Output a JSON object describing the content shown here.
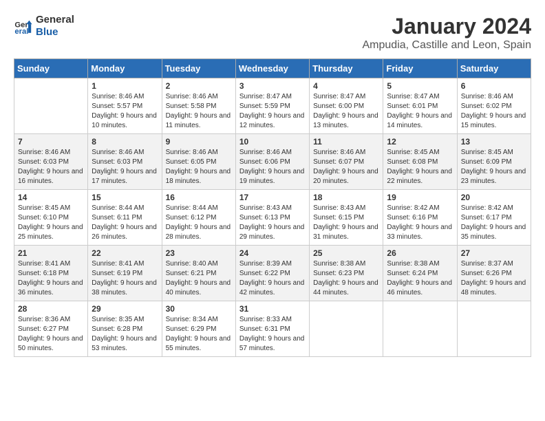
{
  "logo": {
    "line1": "General",
    "line2": "Blue"
  },
  "title": "January 2024",
  "subtitle": "Ampudia, Castille and Leon, Spain",
  "days_of_week": [
    "Sunday",
    "Monday",
    "Tuesday",
    "Wednesday",
    "Thursday",
    "Friday",
    "Saturday"
  ],
  "weeks": [
    [
      {
        "day": "",
        "sunrise": "",
        "sunset": "",
        "daylight": ""
      },
      {
        "day": "1",
        "sunrise": "Sunrise: 8:46 AM",
        "sunset": "Sunset: 5:57 PM",
        "daylight": "Daylight: 9 hours and 10 minutes."
      },
      {
        "day": "2",
        "sunrise": "Sunrise: 8:46 AM",
        "sunset": "Sunset: 5:58 PM",
        "daylight": "Daylight: 9 hours and 11 minutes."
      },
      {
        "day": "3",
        "sunrise": "Sunrise: 8:47 AM",
        "sunset": "Sunset: 5:59 PM",
        "daylight": "Daylight: 9 hours and 12 minutes."
      },
      {
        "day": "4",
        "sunrise": "Sunrise: 8:47 AM",
        "sunset": "Sunset: 6:00 PM",
        "daylight": "Daylight: 9 hours and 13 minutes."
      },
      {
        "day": "5",
        "sunrise": "Sunrise: 8:47 AM",
        "sunset": "Sunset: 6:01 PM",
        "daylight": "Daylight: 9 hours and 14 minutes."
      },
      {
        "day": "6",
        "sunrise": "Sunrise: 8:46 AM",
        "sunset": "Sunset: 6:02 PM",
        "daylight": "Daylight: 9 hours and 15 minutes."
      }
    ],
    [
      {
        "day": "7",
        "sunrise": "Sunrise: 8:46 AM",
        "sunset": "Sunset: 6:03 PM",
        "daylight": "Daylight: 9 hours and 16 minutes."
      },
      {
        "day": "8",
        "sunrise": "Sunrise: 8:46 AM",
        "sunset": "Sunset: 6:03 PM",
        "daylight": "Daylight: 9 hours and 17 minutes."
      },
      {
        "day": "9",
        "sunrise": "Sunrise: 8:46 AM",
        "sunset": "Sunset: 6:05 PM",
        "daylight": "Daylight: 9 hours and 18 minutes."
      },
      {
        "day": "10",
        "sunrise": "Sunrise: 8:46 AM",
        "sunset": "Sunset: 6:06 PM",
        "daylight": "Daylight: 9 hours and 19 minutes."
      },
      {
        "day": "11",
        "sunrise": "Sunrise: 8:46 AM",
        "sunset": "Sunset: 6:07 PM",
        "daylight": "Daylight: 9 hours and 20 minutes."
      },
      {
        "day": "12",
        "sunrise": "Sunrise: 8:45 AM",
        "sunset": "Sunset: 6:08 PM",
        "daylight": "Daylight: 9 hours and 22 minutes."
      },
      {
        "day": "13",
        "sunrise": "Sunrise: 8:45 AM",
        "sunset": "Sunset: 6:09 PM",
        "daylight": "Daylight: 9 hours and 23 minutes."
      }
    ],
    [
      {
        "day": "14",
        "sunrise": "Sunrise: 8:45 AM",
        "sunset": "Sunset: 6:10 PM",
        "daylight": "Daylight: 9 hours and 25 minutes."
      },
      {
        "day": "15",
        "sunrise": "Sunrise: 8:44 AM",
        "sunset": "Sunset: 6:11 PM",
        "daylight": "Daylight: 9 hours and 26 minutes."
      },
      {
        "day": "16",
        "sunrise": "Sunrise: 8:44 AM",
        "sunset": "Sunset: 6:12 PM",
        "daylight": "Daylight: 9 hours and 28 minutes."
      },
      {
        "day": "17",
        "sunrise": "Sunrise: 8:43 AM",
        "sunset": "Sunset: 6:13 PM",
        "daylight": "Daylight: 9 hours and 29 minutes."
      },
      {
        "day": "18",
        "sunrise": "Sunrise: 8:43 AM",
        "sunset": "Sunset: 6:15 PM",
        "daylight": "Daylight: 9 hours and 31 minutes."
      },
      {
        "day": "19",
        "sunrise": "Sunrise: 8:42 AM",
        "sunset": "Sunset: 6:16 PM",
        "daylight": "Daylight: 9 hours and 33 minutes."
      },
      {
        "day": "20",
        "sunrise": "Sunrise: 8:42 AM",
        "sunset": "Sunset: 6:17 PM",
        "daylight": "Daylight: 9 hours and 35 minutes."
      }
    ],
    [
      {
        "day": "21",
        "sunrise": "Sunrise: 8:41 AM",
        "sunset": "Sunset: 6:18 PM",
        "daylight": "Daylight: 9 hours and 36 minutes."
      },
      {
        "day": "22",
        "sunrise": "Sunrise: 8:41 AM",
        "sunset": "Sunset: 6:19 PM",
        "daylight": "Daylight: 9 hours and 38 minutes."
      },
      {
        "day": "23",
        "sunrise": "Sunrise: 8:40 AM",
        "sunset": "Sunset: 6:21 PM",
        "daylight": "Daylight: 9 hours and 40 minutes."
      },
      {
        "day": "24",
        "sunrise": "Sunrise: 8:39 AM",
        "sunset": "Sunset: 6:22 PM",
        "daylight": "Daylight: 9 hours and 42 minutes."
      },
      {
        "day": "25",
        "sunrise": "Sunrise: 8:38 AM",
        "sunset": "Sunset: 6:23 PM",
        "daylight": "Daylight: 9 hours and 44 minutes."
      },
      {
        "day": "26",
        "sunrise": "Sunrise: 8:38 AM",
        "sunset": "Sunset: 6:24 PM",
        "daylight": "Daylight: 9 hours and 46 minutes."
      },
      {
        "day": "27",
        "sunrise": "Sunrise: 8:37 AM",
        "sunset": "Sunset: 6:26 PM",
        "daylight": "Daylight: 9 hours and 48 minutes."
      }
    ],
    [
      {
        "day": "28",
        "sunrise": "Sunrise: 8:36 AM",
        "sunset": "Sunset: 6:27 PM",
        "daylight": "Daylight: 9 hours and 50 minutes."
      },
      {
        "day": "29",
        "sunrise": "Sunrise: 8:35 AM",
        "sunset": "Sunset: 6:28 PM",
        "daylight": "Daylight: 9 hours and 53 minutes."
      },
      {
        "day": "30",
        "sunrise": "Sunrise: 8:34 AM",
        "sunset": "Sunset: 6:29 PM",
        "daylight": "Daylight: 9 hours and 55 minutes."
      },
      {
        "day": "31",
        "sunrise": "Sunrise: 8:33 AM",
        "sunset": "Sunset: 6:31 PM",
        "daylight": "Daylight: 9 hours and 57 minutes."
      },
      {
        "day": "",
        "sunrise": "",
        "sunset": "",
        "daylight": ""
      },
      {
        "day": "",
        "sunrise": "",
        "sunset": "",
        "daylight": ""
      },
      {
        "day": "",
        "sunrise": "",
        "sunset": "",
        "daylight": ""
      }
    ]
  ]
}
